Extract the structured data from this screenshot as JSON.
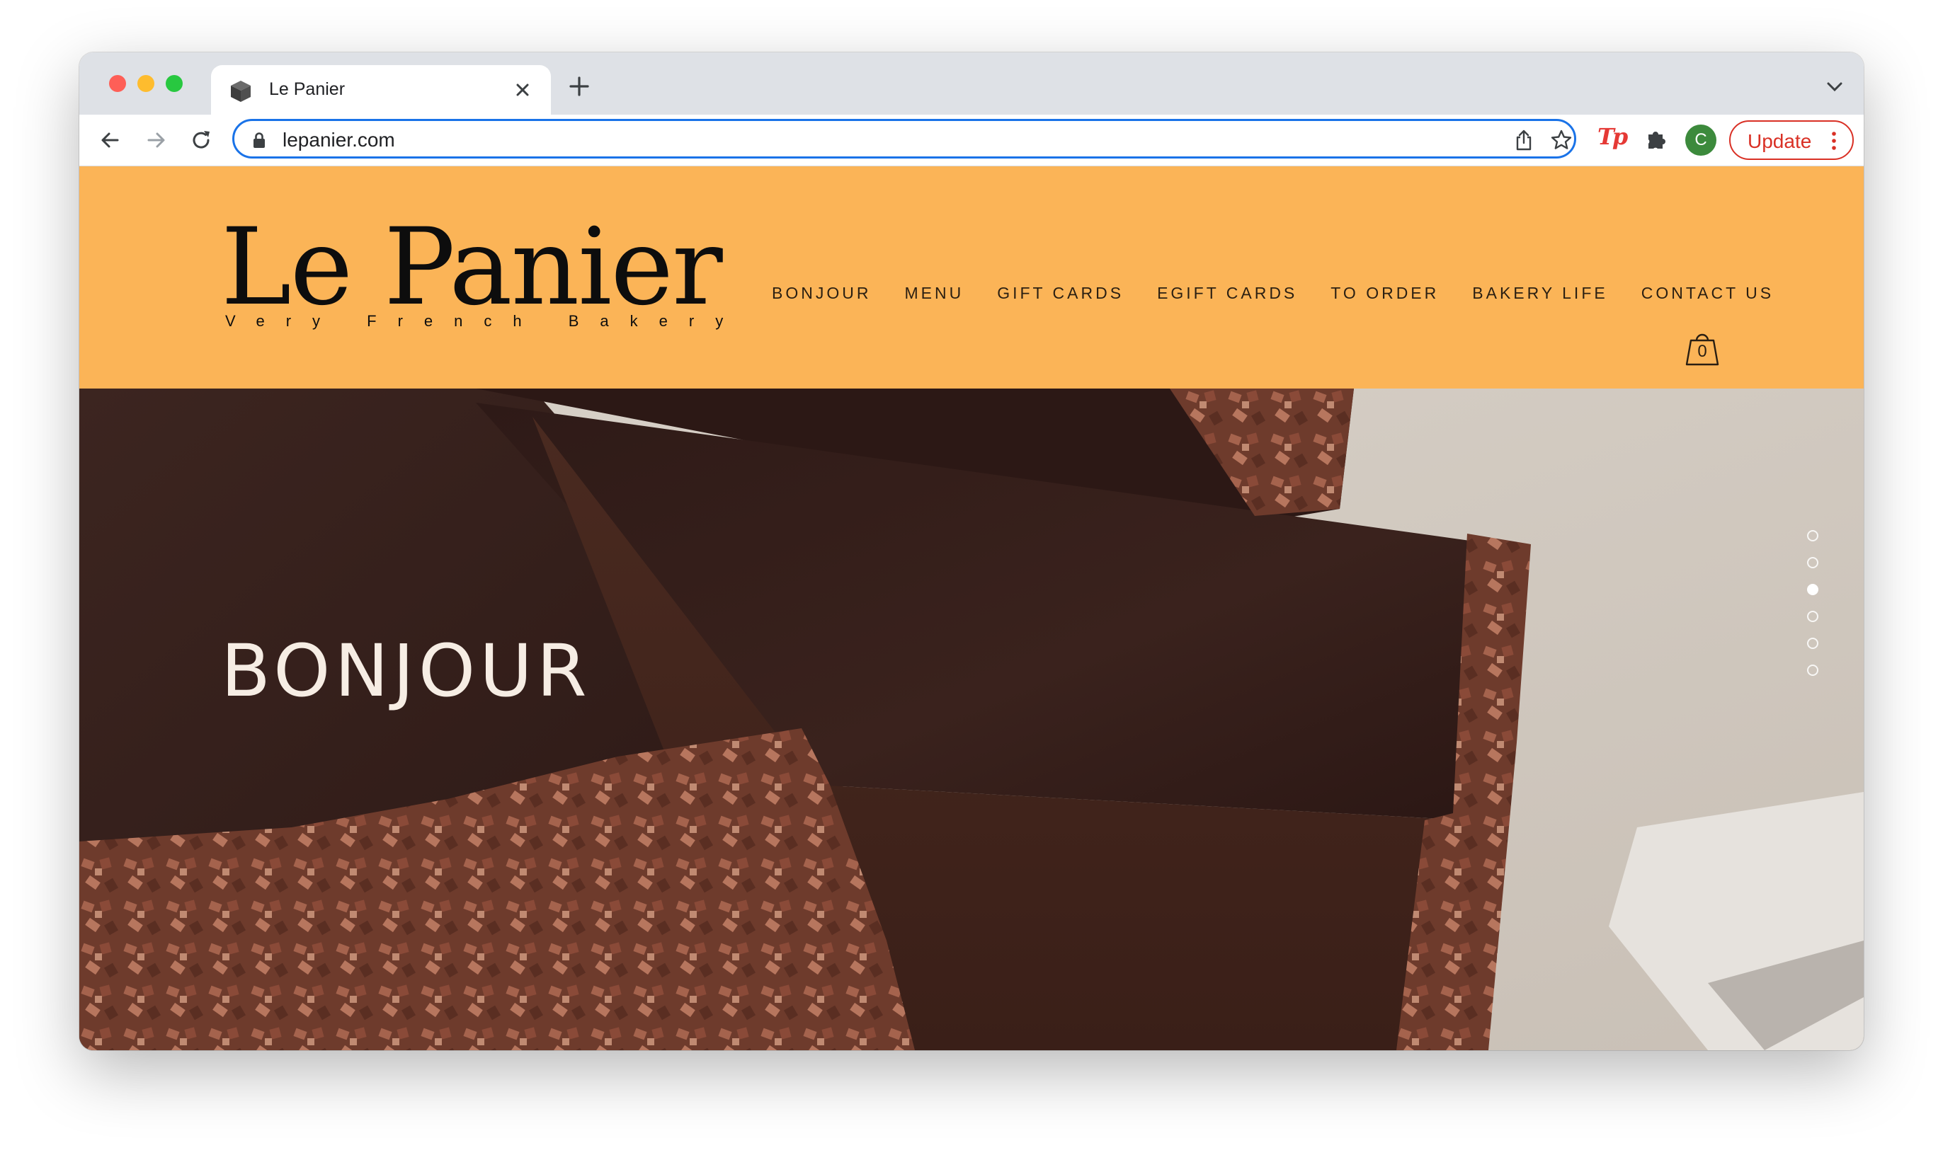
{
  "browser": {
    "tab": {
      "title": "Le Panier",
      "favicon": "cube-favicon-icon"
    },
    "new_tab_icon": "plus-icon",
    "url": "lepanier.com",
    "update_label": "Update",
    "avatar_letter": "C",
    "extension_label": "Tp"
  },
  "site": {
    "logo": {
      "name": "Le Panier",
      "tagline": "Very French Bakery"
    },
    "nav": [
      "BONJOUR",
      "MENU",
      "GIFT CARDS",
      "EGIFT CARDS",
      "TO ORDER",
      "BAKERY LIFE",
      "CONTACT US"
    ],
    "cart_count": "0",
    "hero": {
      "title": "BONJOUR"
    },
    "slider": {
      "count": 6,
      "active_index": 2
    }
  },
  "colors": {
    "header_bg": "#fbb457",
    "accent_focus": "#1a73e8",
    "update_red": "#d93025"
  }
}
